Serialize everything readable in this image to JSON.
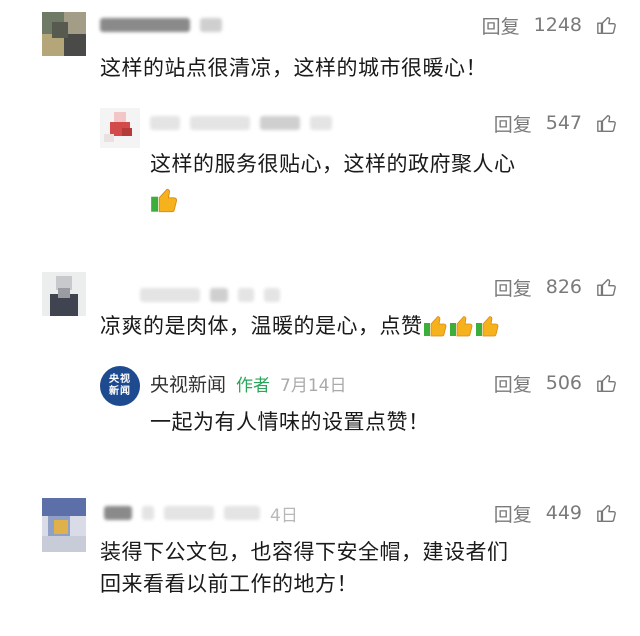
{
  "colors": {
    "author_tag": "#2aa65a",
    "meta": "#7a7a7a",
    "logo_bg": "#1e4a8f"
  },
  "comments": [
    {
      "reply_label": "回复",
      "likes": "1248",
      "text": "这样的站点很清凉，这样的城市很暖心！"
    },
    {
      "reply_label": "回复",
      "likes": "547",
      "text": "这样的服务很贴心，这样的政府聚人心"
    },
    {
      "reply_label": "回复",
      "likes": "826",
      "text": "凉爽的是肉体，温暖的是心，点赞"
    },
    {
      "reply_label": "回复",
      "likes": "506",
      "author_name": "央视新闻",
      "author_tag": "作者",
      "date": "7月14日",
      "logo_text": "央视新闻",
      "text": "一起为有人情味的设置点赞！"
    },
    {
      "reply_label": "回复",
      "likes": "449",
      "date_fragment": "4日",
      "text_line1": "装得下公文包，也容得下安全帽，建设者们",
      "text_line2": "回来看看以前工作的地方！"
    }
  ],
  "icons": {
    "like": "thumbs-up-outline-icon",
    "emoji": "thumbs-up-emoji-icon"
  }
}
